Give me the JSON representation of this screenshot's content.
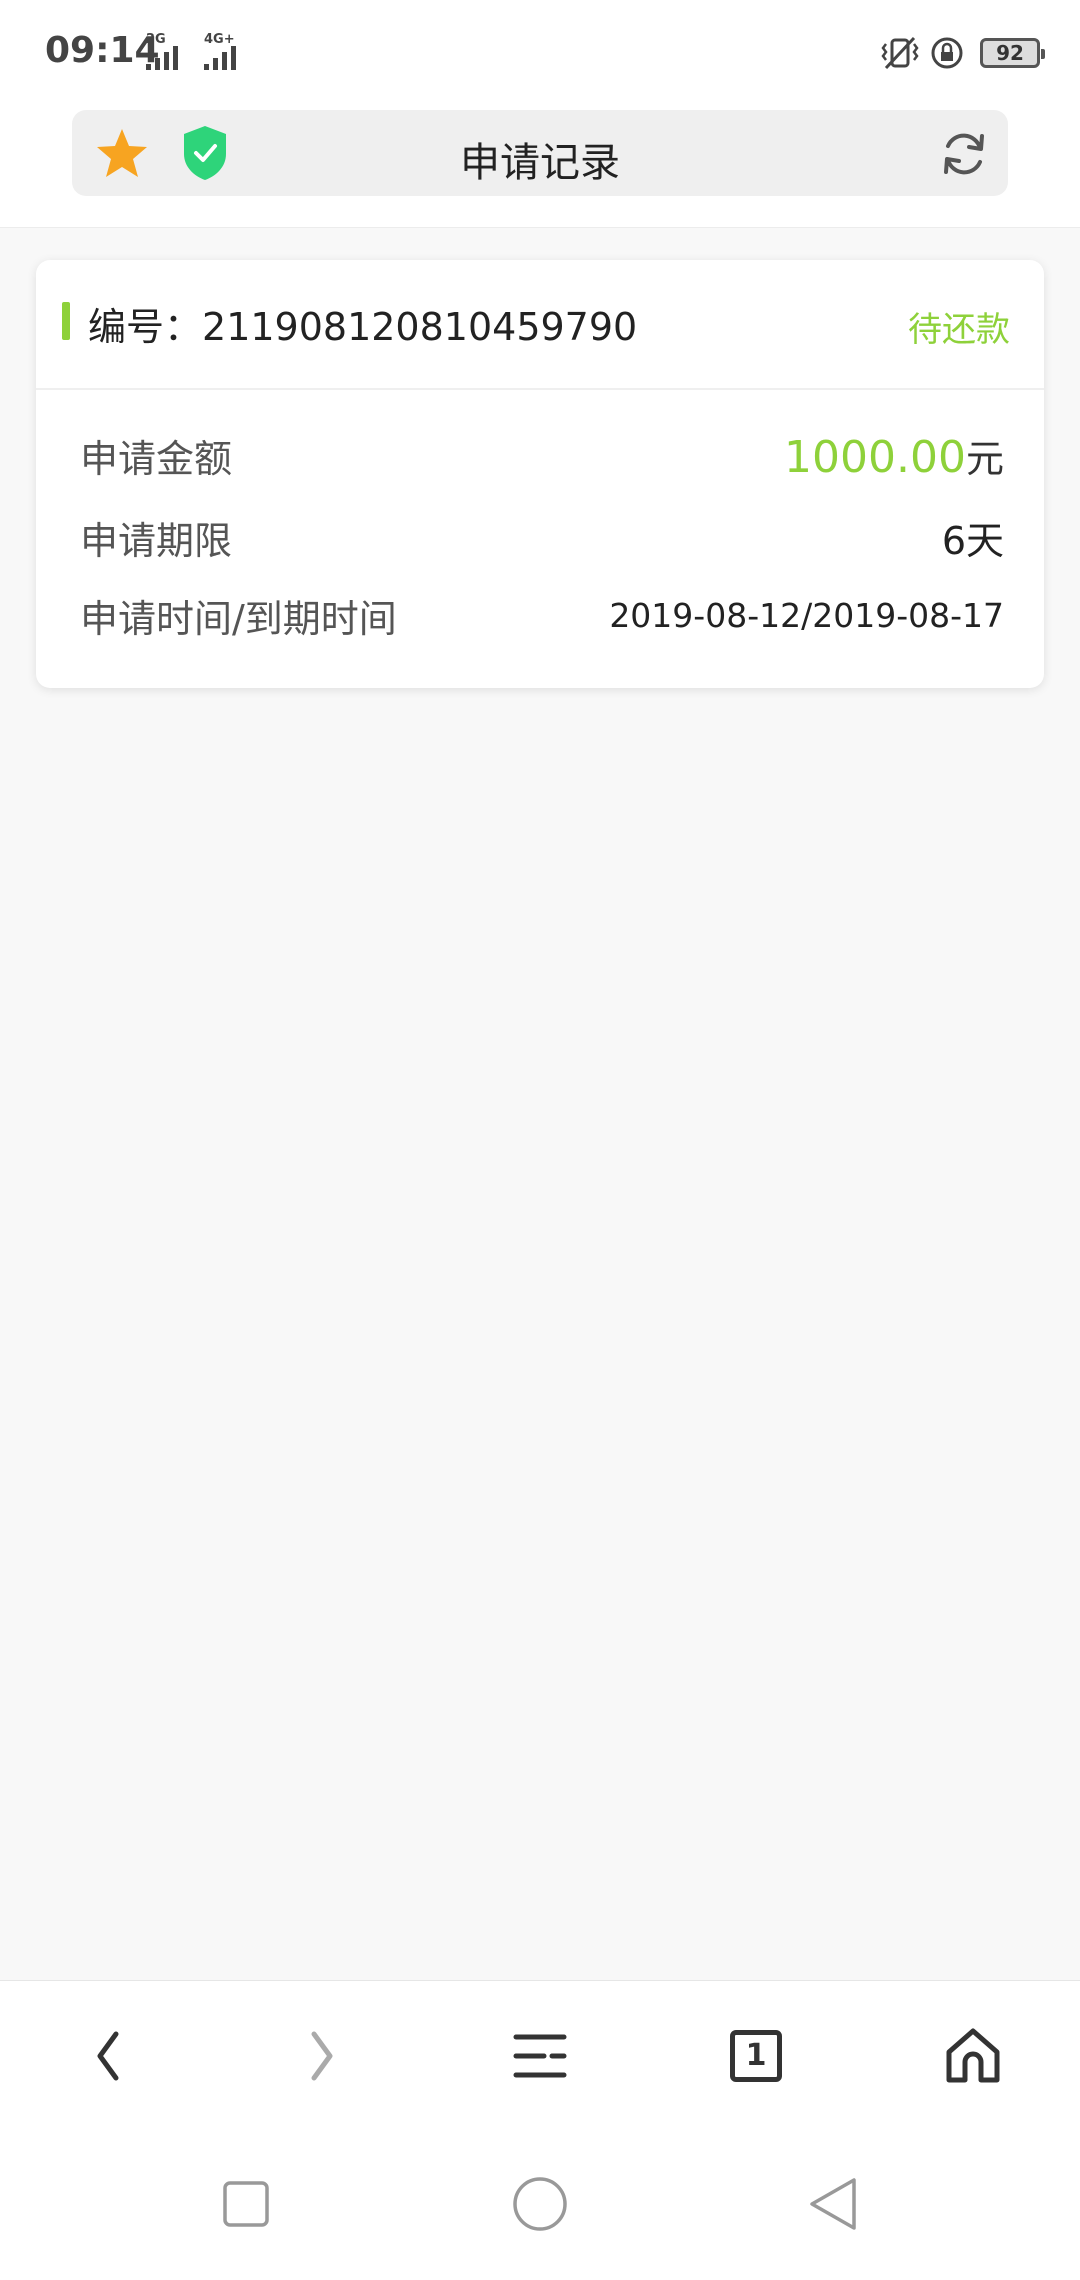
{
  "status_bar": {
    "time": "09:14",
    "network_1": "2G",
    "network_2": "4G+",
    "battery": "92"
  },
  "browser": {
    "page_title": "申请记录"
  },
  "record": {
    "order_label": "编号：",
    "order_number": "211908120810459790",
    "status": "待还款",
    "amount_label": "申请金额",
    "amount_value": "1000.00",
    "amount_unit": "元",
    "term_label": "申请期限",
    "term_value": "6天",
    "date_label": "申请时间/到期时间",
    "date_value": "2019-08-12/2019-08-17"
  },
  "toolbar": {
    "tab_count": "1"
  },
  "colors": {
    "accent_green": "#8ed13a",
    "star_orange": "#f7a421",
    "shield_green": "#2ed47a"
  },
  "icons": [
    "star-icon",
    "shield-check-icon",
    "refresh-icon",
    "back-icon",
    "forward-icon",
    "menu-icon",
    "tabs-icon",
    "home-icon",
    "recent-apps-icon",
    "home-circle-icon",
    "back-triangle-icon"
  ]
}
